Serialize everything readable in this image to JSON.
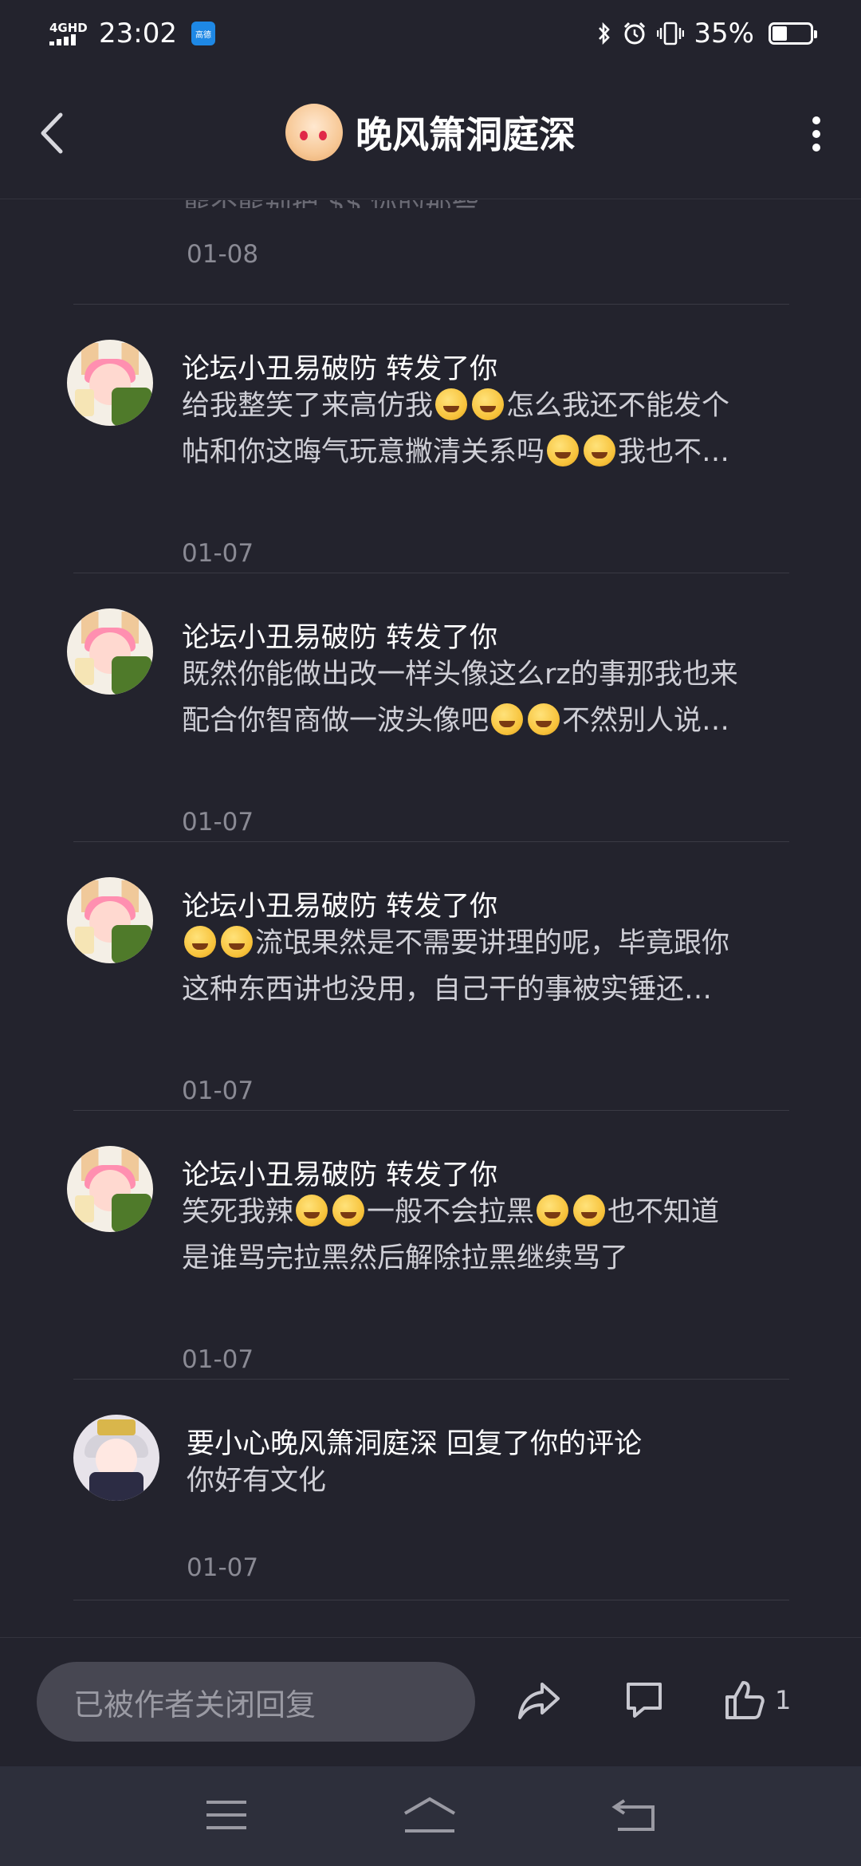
{
  "status": {
    "network": "4GHD",
    "time": "23:02",
    "badge_label": "高德",
    "battery_percent": "35%"
  },
  "header": {
    "title": "晚风箫洞庭深"
  },
  "partial_item": {
    "content": "能不能别把 $$ 你的那些...",
    "date": "01-08"
  },
  "items": [
    {
      "name": "论坛小丑易破防 转发了你",
      "line1_a": "给我整笑了来高仿我",
      "line1_b": "怎么我还不能发个",
      "line2_a": "帖和你这晦气玩意撇清关系吗",
      "line2_b": "我也不…",
      "date": "01-07"
    },
    {
      "name": "论坛小丑易破防 转发了你",
      "line1": "既然你能做出改一样头像这么rz的事那我也来",
      "line2_a": "配合你智商做一波头像吧",
      "line2_b": "不然别人说…",
      "date": "01-07"
    },
    {
      "name": "论坛小丑易破防 转发了你",
      "line1_b": "流氓果然是不需要讲理的呢，毕竟跟你",
      "line2": "这种东西讲也没用，自己干的事被实锤还…",
      "date": "01-07"
    },
    {
      "name": "论坛小丑易破防 转发了你",
      "line1_a": "笑死我辣",
      "line1_b": "一般不会拉黑",
      "line1_c": "也不知道",
      "line2": "是谁骂完拉黑然后解除拉黑继续骂了",
      "date": "01-07"
    },
    {
      "name": "要小心晚风箫洞庭深 回复了你的评论",
      "line1": "你好有文化",
      "date": "01-07"
    }
  ],
  "bottom": {
    "reply_placeholder": "已被作者关闭回复",
    "like_count": "1"
  },
  "icons": {
    "back": "back-arrow-icon",
    "more": "more-vertical-icon",
    "share": "share-icon",
    "comment": "comment-icon",
    "like": "thumbs-up-icon",
    "nav_menu": "menu-icon",
    "nav_home": "home-icon",
    "nav_back": "back-icon"
  }
}
